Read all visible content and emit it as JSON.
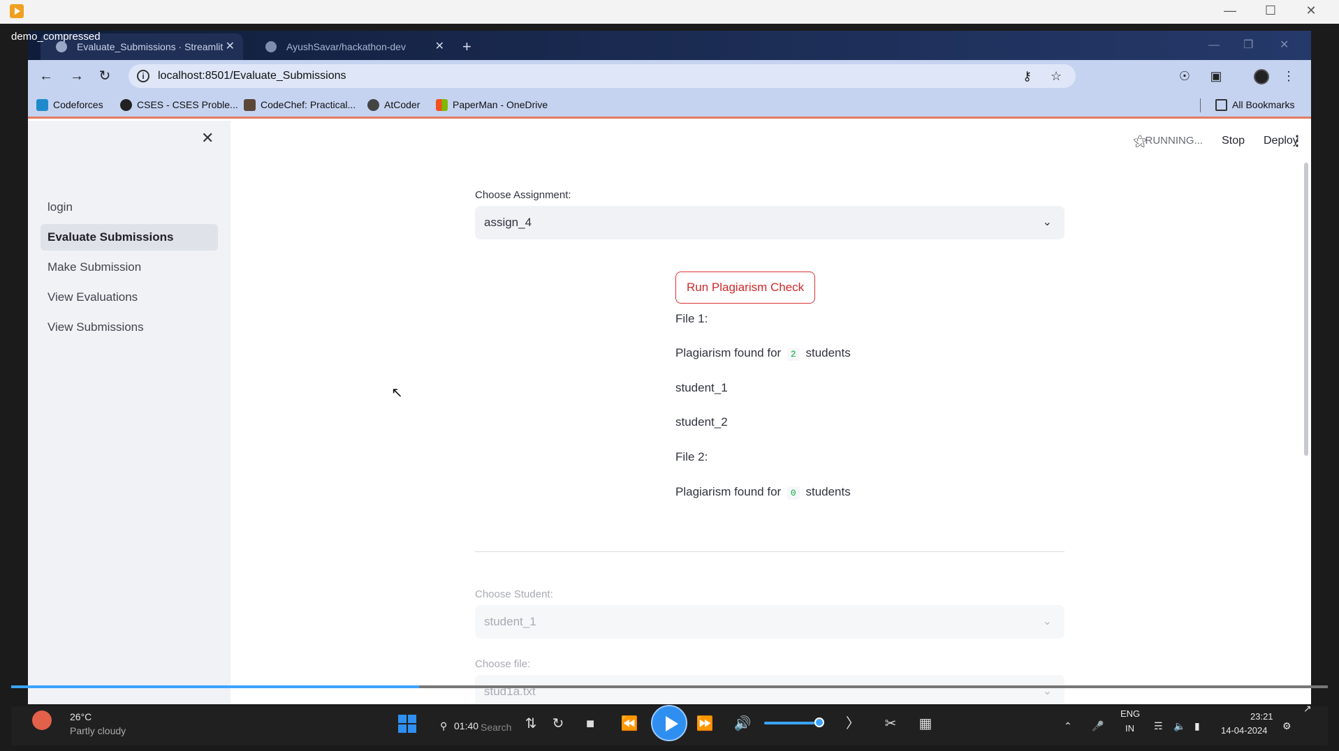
{
  "player": {
    "video_title": "demo_compressed",
    "time": "01:40",
    "progress_fraction": 0.31,
    "volume_fraction": 0.8
  },
  "browser": {
    "tabs": [
      {
        "label": "Evaluate_Submissions · Streamlit",
        "active": true
      },
      {
        "label": "AyushSavar/hackathon-dev",
        "active": false
      }
    ],
    "url": "localhost:8501/Evaluate_Submissions",
    "bookmarks": [
      {
        "label": "Codeforces",
        "color": "#1f8acb"
      },
      {
        "label": "CSES - CSES Proble...",
        "color": "#222222"
      },
      {
        "label": "CodeChef: Practical...",
        "color": "#5b4638"
      },
      {
        "label": "AtCoder",
        "color": "#444444"
      },
      {
        "label": "PaperMan - OneDrive",
        "color": "#e65100"
      }
    ],
    "all_bookmarks": "All Bookmarks"
  },
  "sidebar": {
    "items": [
      {
        "label": "login",
        "active": false
      },
      {
        "label": "Evaluate Submissions",
        "active": true
      },
      {
        "label": "Make Submission",
        "active": false
      },
      {
        "label": "View Evaluations",
        "active": false
      },
      {
        "label": "View Submissions",
        "active": false
      }
    ]
  },
  "header": {
    "status": "RUNNING...",
    "stop": "Stop",
    "deploy": "Deploy"
  },
  "main": {
    "assignment_label": "Choose Assignment:",
    "assignment_value": "assign_4",
    "run_button": "Run Plagiarism Check",
    "file1_title": "File 1:",
    "file1_prefix": "Plagiarism found for",
    "file1_count": "2",
    "file1_suffix": "students",
    "students": [
      "student_1",
      "student_2"
    ],
    "file2_title": "File 2:",
    "file2_prefix": "Plagiarism found for",
    "file2_count": "0",
    "file2_suffix": "students",
    "student_label": "Choose Student:",
    "student_value": "student_1",
    "file_label": "Choose file:",
    "file_value": "stud1a.txt"
  },
  "taskbar": {
    "temperature": "26°C",
    "weather": "Partly cloudy",
    "search": "Search",
    "lang_top": "ENG",
    "lang_bottom": "IN",
    "clock_time": "23:21",
    "clock_date": "14-04-2024"
  }
}
